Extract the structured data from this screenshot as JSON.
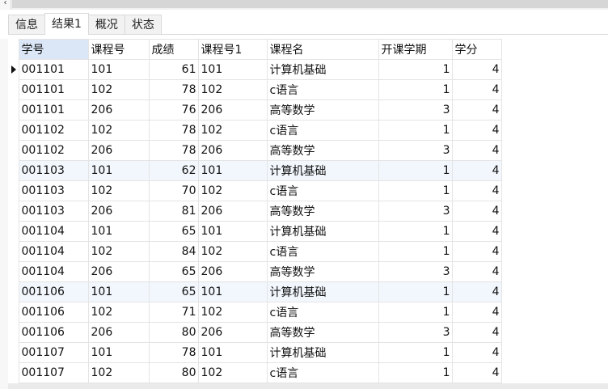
{
  "tabs": [
    {
      "label": "信息",
      "active": false
    },
    {
      "label": "结果1",
      "active": true
    },
    {
      "label": "概况",
      "active": false
    },
    {
      "label": "状态",
      "active": false
    }
  ],
  "columns": [
    "学号",
    "课程号",
    "成绩",
    "课程号1",
    "课程名",
    "开课学期",
    "学分"
  ],
  "rows": [
    [
      "001101",
      "101",
      "61",
      "101",
      "计算机基础",
      "1",
      "4"
    ],
    [
      "001101",
      "102",
      "78",
      "102",
      "c语言",
      "1",
      "4"
    ],
    [
      "001101",
      "206",
      "76",
      "206",
      "高等数学",
      "3",
      "4"
    ],
    [
      "001102",
      "102",
      "78",
      "102",
      "c语言",
      "1",
      "4"
    ],
    [
      "001102",
      "206",
      "78",
      "206",
      "高等数学",
      "3",
      "4"
    ],
    [
      "001103",
      "101",
      "62",
      "101",
      "计算机基础",
      "1",
      "4"
    ],
    [
      "001103",
      "102",
      "70",
      "102",
      "c语言",
      "1",
      "4"
    ],
    [
      "001103",
      "206",
      "81",
      "206",
      "高等数学",
      "3",
      "4"
    ],
    [
      "001104",
      "101",
      "65",
      "101",
      "计算机基础",
      "1",
      "4"
    ],
    [
      "001104",
      "102",
      "84",
      "102",
      "c语言",
      "1",
      "4"
    ],
    [
      "001104",
      "206",
      "65",
      "206",
      "高等数学",
      "3",
      "4"
    ],
    [
      "001106",
      "101",
      "65",
      "101",
      "计算机基础",
      "1",
      "4"
    ],
    [
      "001106",
      "102",
      "71",
      "102",
      "c语言",
      "1",
      "4"
    ],
    [
      "001106",
      "206",
      "80",
      "206",
      "高等数学",
      "3",
      "4"
    ],
    [
      "001107",
      "101",
      "78",
      "101",
      "计算机基础",
      "1",
      "4"
    ],
    [
      "001107",
      "102",
      "80",
      "102",
      "c语言",
      "1",
      "4"
    ]
  ],
  "current_row": 0,
  "highlighted_rows": [
    5,
    11
  ],
  "sorted_column": 0,
  "numeric_columns": [
    2,
    5,
    6
  ],
  "colors": {
    "sorted_header": "#dbe7f7",
    "highlight_row": "#f2f7fd",
    "grid_line": "#e4e4e4"
  }
}
